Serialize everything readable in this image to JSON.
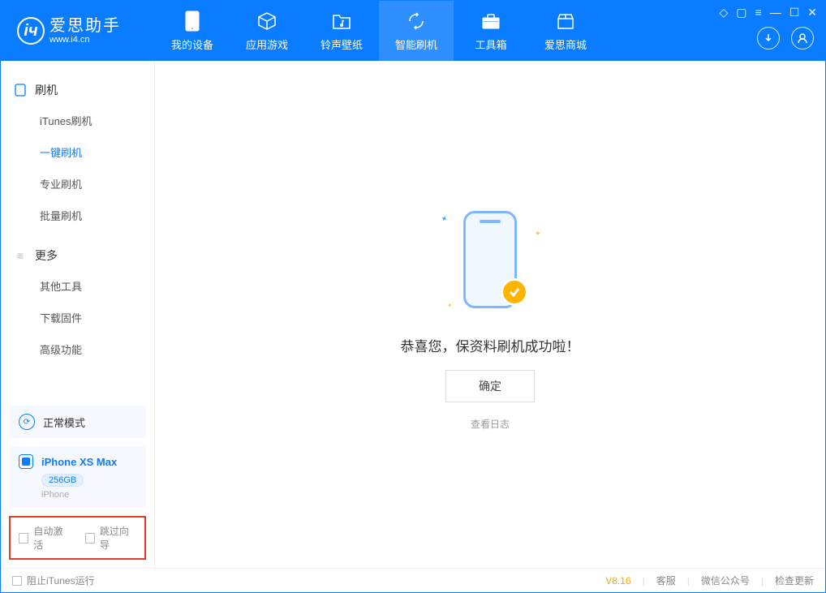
{
  "app": {
    "name": "爱思助手",
    "domain": "www.i4.cn"
  },
  "tabs": {
    "device": "我的设备",
    "apps": "应用游戏",
    "ring": "铃声壁纸",
    "flash": "智能刷机",
    "toolbox": "工具箱",
    "store": "爱思商城"
  },
  "sidebar": {
    "group1": {
      "title": "刷机",
      "items": [
        "iTunes刷机",
        "一键刷机",
        "专业刷机",
        "批量刷机"
      ]
    },
    "group2": {
      "title": "更多",
      "items": [
        "其他工具",
        "下载固件",
        "高级功能"
      ]
    }
  },
  "mode": {
    "label": "正常模式"
  },
  "device": {
    "name": "iPhone XS Max",
    "storage": "256GB",
    "type": "iPhone"
  },
  "options": {
    "auto_activate": "自动激活",
    "skip_guide": "跳过向导"
  },
  "main": {
    "success": "恭喜您，保资料刷机成功啦！",
    "ok": "确定",
    "view_log": "查看日志"
  },
  "status": {
    "block_itunes": "阻止iTunes运行",
    "version": "V8.16",
    "support": "客服",
    "wechat": "微信公众号",
    "update": "检查更新"
  }
}
